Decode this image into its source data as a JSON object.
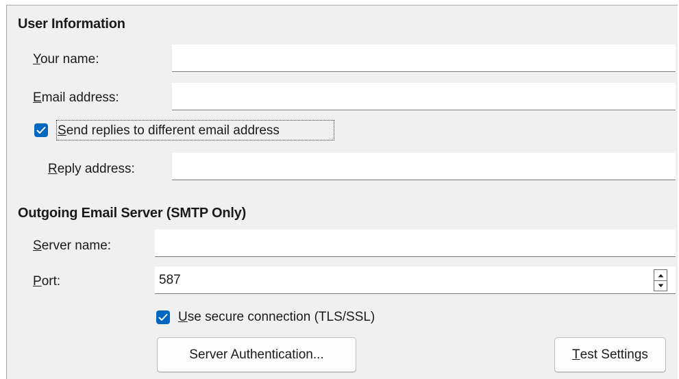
{
  "user_info": {
    "title": "User Information",
    "name_label_mnemonic": "Y",
    "name_label_rest": "our name:",
    "name_value": "",
    "email_label_mnemonic": "E",
    "email_label_rest": "mail address:",
    "email_value": "",
    "send_replies_mnemonic": "S",
    "send_replies_rest": "end replies to different email address",
    "send_replies_checked": true,
    "reply_label_mnemonic": "R",
    "reply_label_rest": "eply address:",
    "reply_value": ""
  },
  "smtp": {
    "title": "Outgoing Email Server (SMTP Only)",
    "server_label_mnemonic": "S",
    "server_label_rest": "erver name:",
    "server_value": "",
    "port_label_mnemonic": "P",
    "port_label_rest": "ort:",
    "port_value": "587",
    "secure_mnemonic": "U",
    "secure_rest": "se secure connection (TLS/SSL)",
    "secure_checked": true,
    "auth_button": "Server Authentication...",
    "test_button_mnemonic": "T",
    "test_button_rest": "est Settings"
  },
  "colors": {
    "accent": "#0067c0",
    "panel_bg": "#f0f0f0"
  },
  "icons": {
    "checkmark": "checkmark-icon",
    "spin_up": "spin-up-icon",
    "spin_down": "spin-down-icon"
  }
}
